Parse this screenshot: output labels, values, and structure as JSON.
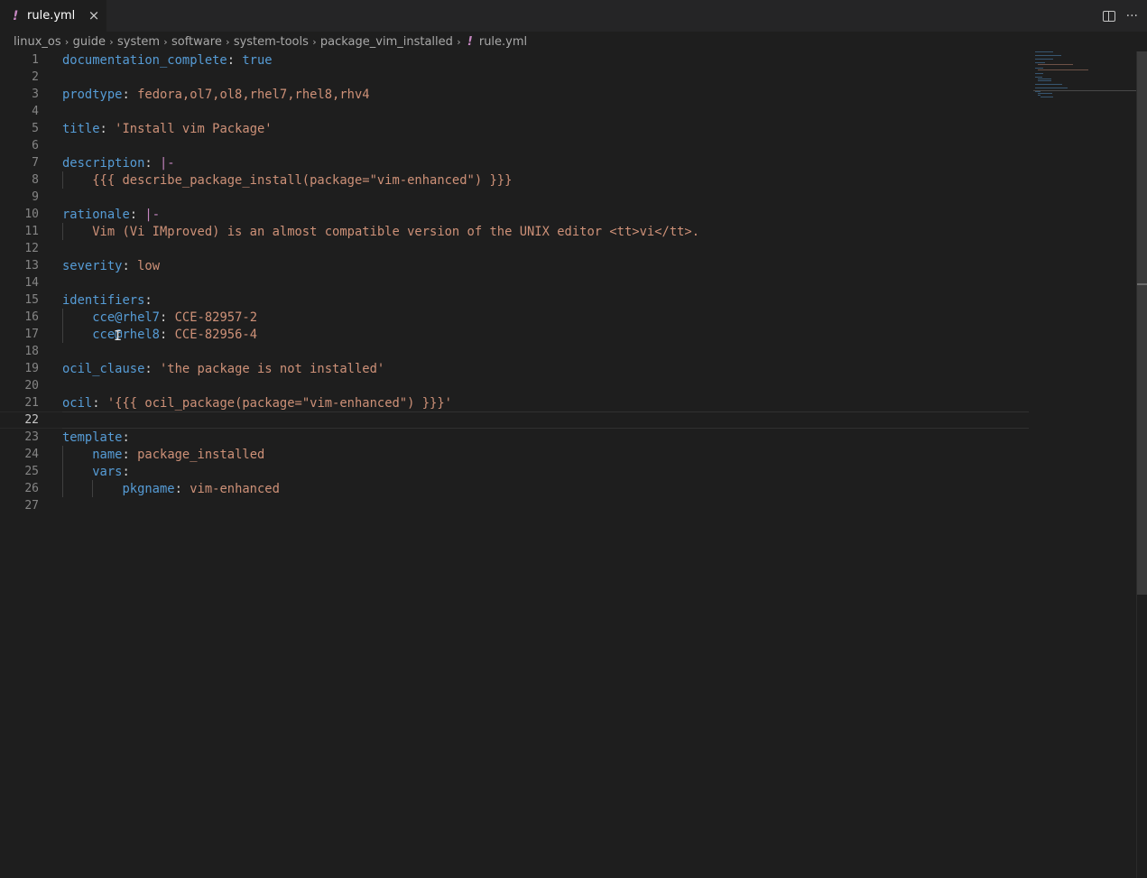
{
  "tab": {
    "icon": "yaml-file-icon",
    "label": "rule.yml",
    "close": "×"
  },
  "actions": {
    "split": "split-editor-icon",
    "more": "···"
  },
  "breadcrumb": [
    "linux_os",
    "guide",
    "system",
    "software",
    "system-tools",
    "package_vim_installed",
    "rule.yml"
  ],
  "lines": [
    {
      "n": "1",
      "k": "documentation_complete",
      "v": "true",
      "vc": "k"
    },
    {
      "n": "2"
    },
    {
      "n": "3",
      "k": "prodtype",
      "v": "fedora,ol7,ol8,rhel7,rhel8,rhv4",
      "vc": "s"
    },
    {
      "n": "4"
    },
    {
      "n": "5",
      "k": "title",
      "v": "'Install vim Package'",
      "vc": "s"
    },
    {
      "n": "6"
    },
    {
      "n": "7",
      "k": "description",
      "v": "|-",
      "vc": "b"
    },
    {
      "n": "8",
      "raw": "    {{{ describe_package_install(package=\"vim-enhanced\") }}}",
      "vc": "s"
    },
    {
      "n": "9"
    },
    {
      "n": "10",
      "k": "rationale",
      "v": "|-",
      "vc": "b"
    },
    {
      "n": "11",
      "raw": "    Vim (Vi IMproved) is an almost compatible version of the UNIX editor <tt>vi</tt>.",
      "vc": "s"
    },
    {
      "n": "12"
    },
    {
      "n": "13",
      "k": "severity",
      "v": "low",
      "vc": "s"
    },
    {
      "n": "14"
    },
    {
      "n": "15",
      "k": "identifiers",
      "v": "",
      "vc": "s"
    },
    {
      "n": "16",
      "indent": "    ",
      "k": "cce@rhel7",
      "v": "CCE-82957-2",
      "vc": "s"
    },
    {
      "n": "17",
      "indent": "    ",
      "k": "cce@rhel8",
      "v": "CCE-82956-4",
      "vc": "s"
    },
    {
      "n": "18"
    },
    {
      "n": "19",
      "k": "ocil_clause",
      "v": "'the package is not installed'",
      "vc": "s"
    },
    {
      "n": "20"
    },
    {
      "n": "21",
      "k": "ocil",
      "v": "'{{{ ocil_package(package=\"vim-enhanced\") }}}'",
      "vc": "s"
    },
    {
      "n": "22",
      "current": true
    },
    {
      "n": "23",
      "k": "template",
      "v": "",
      "vc": "s"
    },
    {
      "n": "24",
      "indent": "    ",
      "k": "name",
      "v": "package_installed",
      "vc": "s"
    },
    {
      "n": "25",
      "indent": "    ",
      "k": "vars",
      "v": "",
      "vc": "s"
    },
    {
      "n": "26",
      "indent": "        ",
      "k": "pkgname",
      "v": "vim-enhanced",
      "vc": "s"
    },
    {
      "n": "27"
    }
  ],
  "colors": {
    "key": "#569cd6",
    "string": "#ce9178",
    "block": "#c586c0",
    "background": "#1e1e1e"
  }
}
